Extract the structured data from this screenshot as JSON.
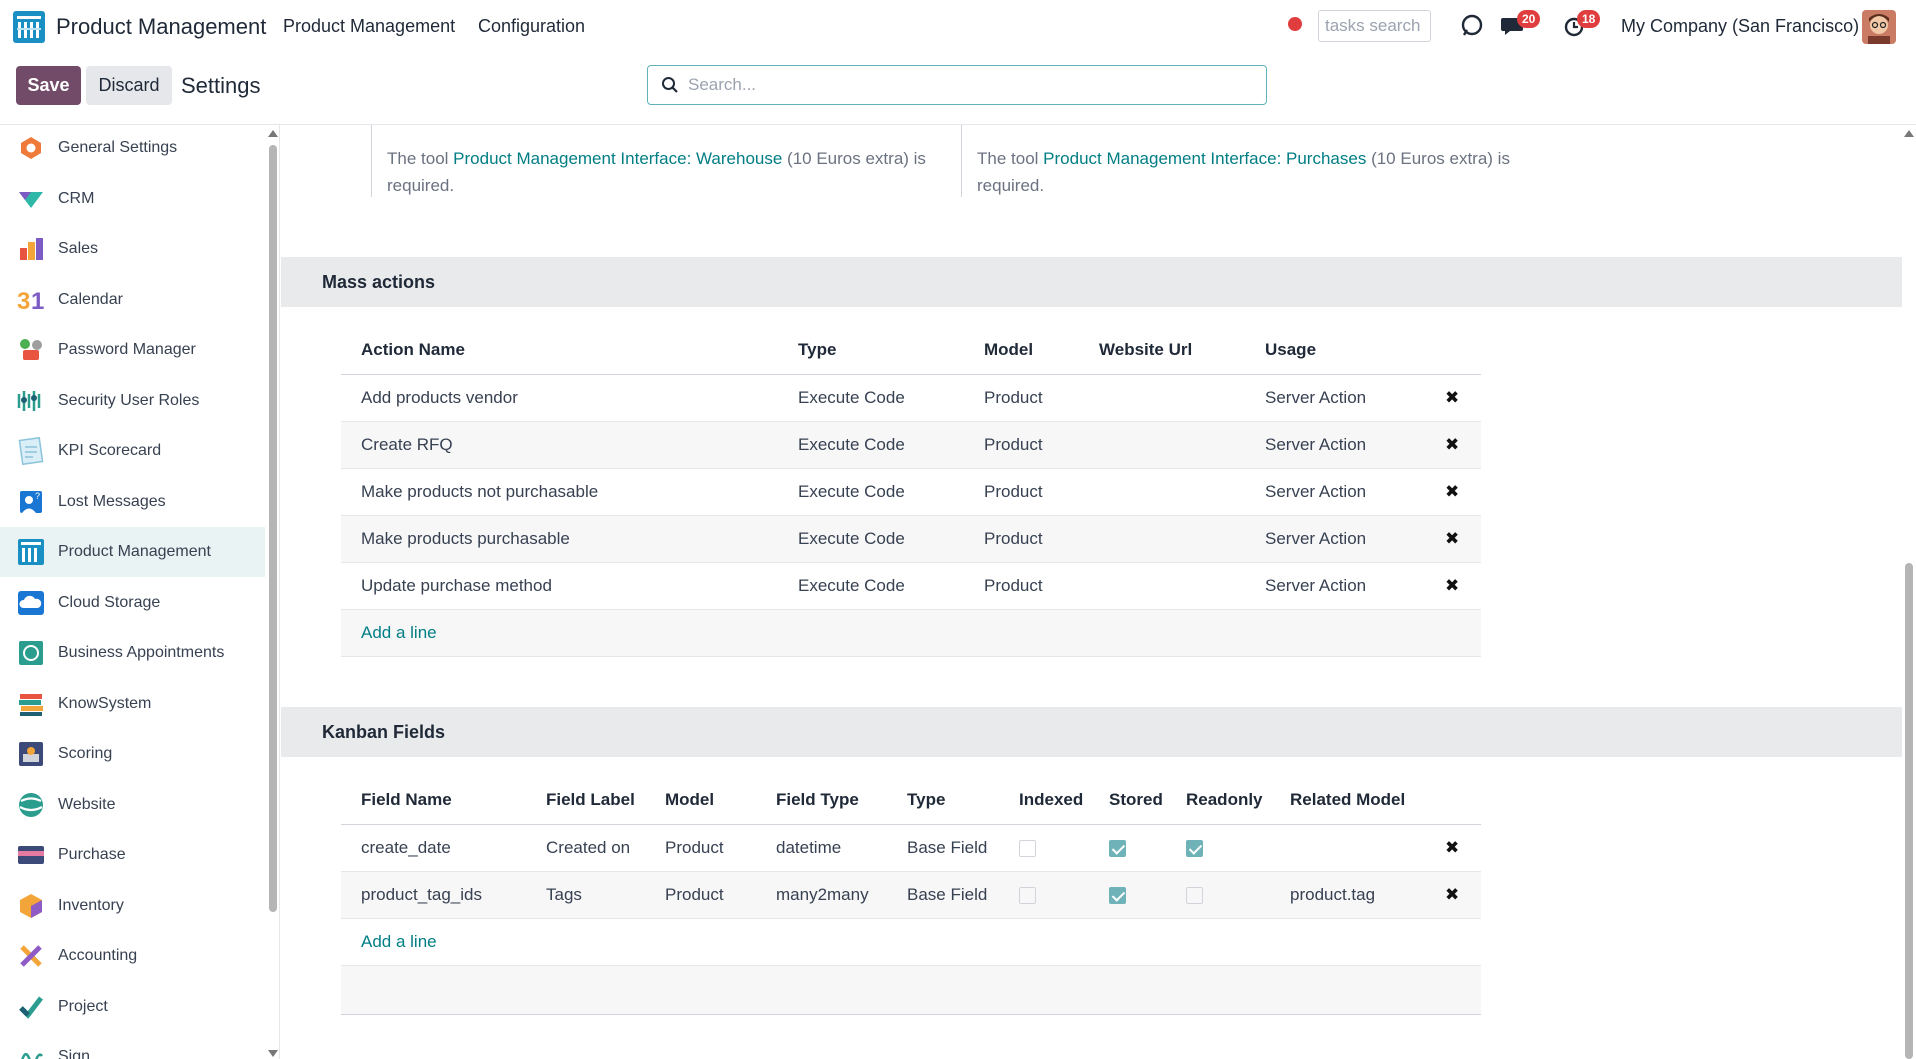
{
  "topbar": {
    "app_name": "Product Management",
    "menu": [
      "Product Management",
      "Configuration"
    ],
    "tasks_search_placeholder": "tasks search",
    "messages_badge": "20",
    "activities_badge": "18",
    "company": "My Company (San Francisco)"
  },
  "control": {
    "save_label": "Save",
    "discard_label": "Discard",
    "title": "Settings",
    "search_placeholder": "Search..."
  },
  "sidebar": {
    "items": [
      {
        "label": "General Settings",
        "icon": "general-settings-icon"
      },
      {
        "label": "CRM",
        "icon": "crm-icon"
      },
      {
        "label": "Sales",
        "icon": "sales-icon"
      },
      {
        "label": "Calendar",
        "icon": "calendar-icon"
      },
      {
        "label": "Password Manager",
        "icon": "password-manager-icon"
      },
      {
        "label": "Security User Roles",
        "icon": "security-roles-icon"
      },
      {
        "label": "KPI Scorecard",
        "icon": "kpi-scorecard-icon"
      },
      {
        "label": "Lost Messages",
        "icon": "lost-messages-icon"
      },
      {
        "label": "Product Management",
        "icon": "product-management-icon"
      },
      {
        "label": "Cloud Storage",
        "icon": "cloud-storage-icon"
      },
      {
        "label": "Business Appointments",
        "icon": "appointments-icon"
      },
      {
        "label": "KnowSystem",
        "icon": "knowsystem-icon"
      },
      {
        "label": "Scoring",
        "icon": "scoring-icon"
      },
      {
        "label": "Website",
        "icon": "website-icon"
      },
      {
        "label": "Purchase",
        "icon": "purchase-icon"
      },
      {
        "label": "Inventory",
        "icon": "inventory-icon"
      },
      {
        "label": "Accounting",
        "icon": "accounting-icon"
      },
      {
        "label": "Project",
        "icon": "project-icon"
      },
      {
        "label": "Sign",
        "icon": "sign-icon"
      }
    ]
  },
  "notes": {
    "left": {
      "prefix": "The tool ",
      "link": "Product Management Interface: Warehouse",
      "suffix": " (10 Euros extra) is required."
    },
    "right": {
      "prefix": "The tool ",
      "link": "Product Management Interface: Purchases",
      "suffix": " (10 Euros extra) is required."
    }
  },
  "mass_actions": {
    "title": "Mass actions",
    "headers": [
      "Action Name",
      "Type",
      "Model",
      "Website Url",
      "Usage"
    ],
    "rows": [
      {
        "name": "Add products vendor",
        "type": "Execute Code",
        "model": "Product",
        "url": "",
        "usage": "Server Action"
      },
      {
        "name": "Create RFQ",
        "type": "Execute Code",
        "model": "Product",
        "url": "",
        "usage": "Server Action"
      },
      {
        "name": "Make products not purchasable",
        "type": "Execute Code",
        "model": "Product",
        "url": "",
        "usage": "Server Action"
      },
      {
        "name": "Make products purchasable",
        "type": "Execute Code",
        "model": "Product",
        "url": "",
        "usage": "Server Action"
      },
      {
        "name": "Update purchase method",
        "type": "Execute Code",
        "model": "Product",
        "url": "",
        "usage": "Server Action"
      }
    ],
    "add_line": "Add a line"
  },
  "kanban_fields": {
    "title": "Kanban Fields",
    "headers": [
      "Field Name",
      "Field Label",
      "Model",
      "Field Type",
      "Type",
      "Indexed",
      "Stored",
      "Readonly",
      "Related Model"
    ],
    "rows": [
      {
        "name": "create_date",
        "label": "Created on",
        "model": "Product",
        "ftype": "datetime",
        "type": "Base Field",
        "indexed": false,
        "stored": true,
        "readonly": true,
        "related": ""
      },
      {
        "name": "product_tag_ids",
        "label": "Tags",
        "model": "Product",
        "ftype": "many2many",
        "type": "Base Field",
        "indexed": false,
        "stored": true,
        "readonly": false,
        "related": "product.tag"
      }
    ],
    "add_line": "Add a line"
  },
  "colors": {
    "brand": "#714b67",
    "link": "#017e84",
    "badge": "#e03e3e"
  }
}
